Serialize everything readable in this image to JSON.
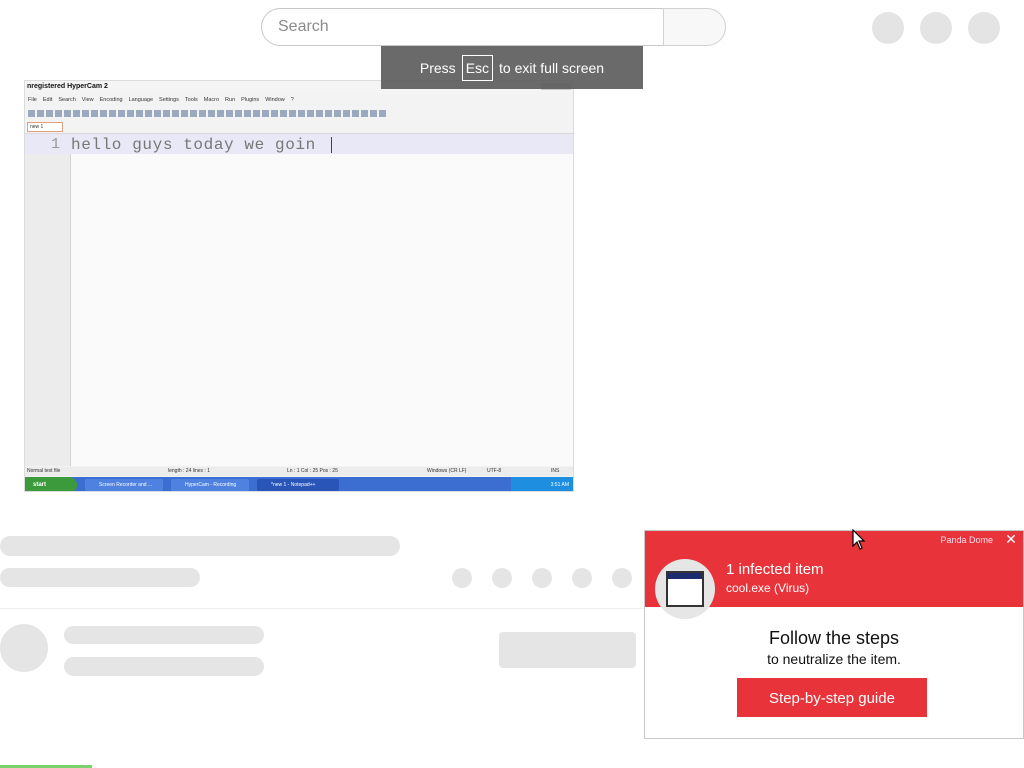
{
  "search": {
    "placeholder": "Search"
  },
  "fullscreen_hint": {
    "before": "Press",
    "key": "Esc",
    "after": "to exit full screen"
  },
  "video": {
    "title": "nregistered HyperCam 2",
    "menu": [
      "File",
      "Edit",
      "Search",
      "View",
      "Encoding",
      "Language",
      "Settings",
      "Tools",
      "Macro",
      "Run",
      "Plugins",
      "Window",
      "?"
    ],
    "tab": "new 1",
    "line_number": "1",
    "editor_text": "hello guys today we goin",
    "status": {
      "file_type": "Normal text file",
      "length": "length : 24   lines : 1",
      "position": "Ln : 1   Col : 25   Pos : 25",
      "eol": "Windows (CR LF)",
      "encoding": "UTF-8",
      "mode": "INS"
    },
    "taskbar": {
      "start": "start",
      "tasks": [
        "Screen Recorder and ...",
        "HyperCam - Recording",
        "*new 1 - Notepad++"
      ],
      "clock": "3:51 AM"
    }
  },
  "panda": {
    "brand": "Panda Dome",
    "close": "✕",
    "heading": "1 infected item",
    "subheading": "cool.exe (Virus)",
    "follow": "Follow the steps",
    "neutralize": "to neutralize the item.",
    "button": "Step-by-step guide",
    "colors": {
      "accent": "#e8333a"
    }
  }
}
